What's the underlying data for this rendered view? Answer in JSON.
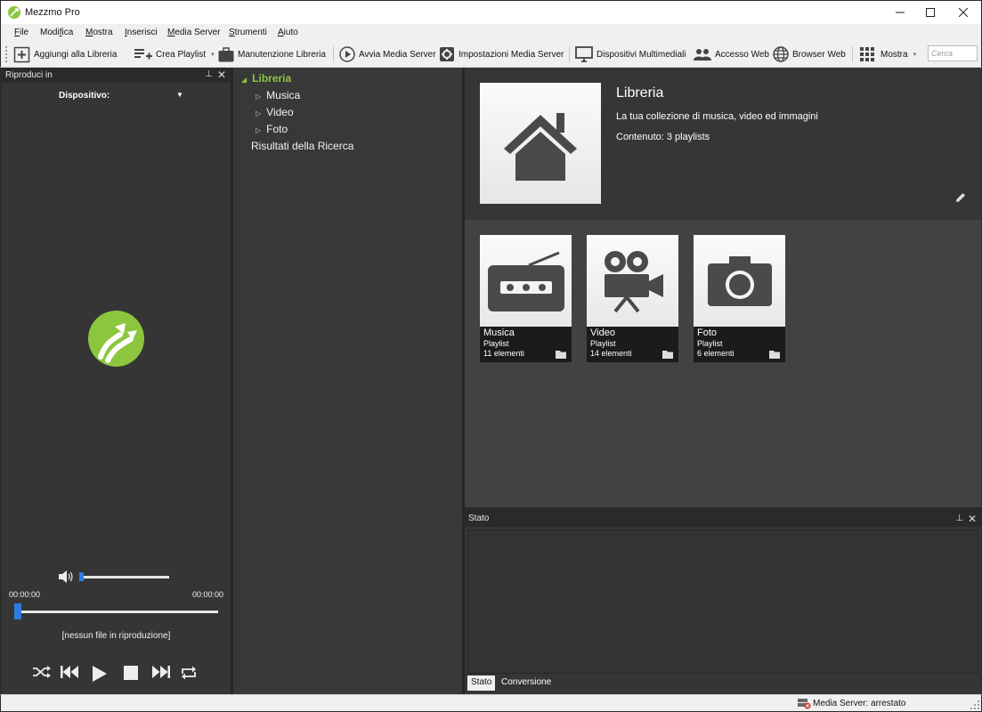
{
  "window": {
    "title": "Mezzmo Pro"
  },
  "menu": {
    "items": [
      {
        "pre": "",
        "ul": "F",
        "post": "ile"
      },
      {
        "pre": "Modi",
        "ul": "f",
        "post": "ica"
      },
      {
        "pre": "",
        "ul": "M",
        "post": "ostra"
      },
      {
        "pre": "",
        "ul": "I",
        "post": "nserisci"
      },
      {
        "pre": "",
        "ul": "M",
        "post": "edia Server"
      },
      {
        "pre": "",
        "ul": "S",
        "post": "trumenti"
      },
      {
        "pre": "",
        "ul": "A",
        "post": "iuto"
      }
    ]
  },
  "toolbar": {
    "add_library": "Aggiungi alla Libreria",
    "create_playlist": "Crea Playlist",
    "maintenance": "Manutenzione Libreria",
    "start_server": "Avvia Media Server",
    "server_settings": "Impostazioni Media Server",
    "devices": "Dispositivi Multimediali",
    "web_access": "Accesso Web",
    "web_browser": "Browser Web",
    "show": "Mostra",
    "search_placeholder": "Cerca"
  },
  "player": {
    "panel_title": "Riproduci in",
    "device_label": "Dispositivo:",
    "time_elapsed": "00:00:00",
    "time_total": "00:00:00",
    "now_playing": "[nessun file in riproduzione]",
    "volume_level": 0.02,
    "progress": 0.0
  },
  "tree": {
    "root": "Libreria",
    "children": [
      "Musica",
      "Video",
      "Foto"
    ],
    "search_results": "Risultati della Ricerca"
  },
  "library": {
    "title": "Libreria",
    "description": "La tua collezione di musica, video ed immagini",
    "content": "Contenuto: 3 playlists",
    "cards": [
      {
        "name": "Musica",
        "type": "Playlist",
        "count": "11 elementi",
        "icon": "radio-icon"
      },
      {
        "name": "Video",
        "type": "Playlist",
        "count": "14 elementi",
        "icon": "movie-camera-icon"
      },
      {
        "name": "Foto",
        "type": "Playlist",
        "count": "6 elementi",
        "icon": "photo-camera-icon"
      }
    ]
  },
  "status_panel": {
    "title": "Stato",
    "tabs": [
      "Stato",
      "Conversione"
    ]
  },
  "statusbar": {
    "text": "Media Server: arrestato"
  },
  "colors": {
    "accent": "#8cc63f",
    "slider": "#2d7de0",
    "panel": "#353535"
  }
}
